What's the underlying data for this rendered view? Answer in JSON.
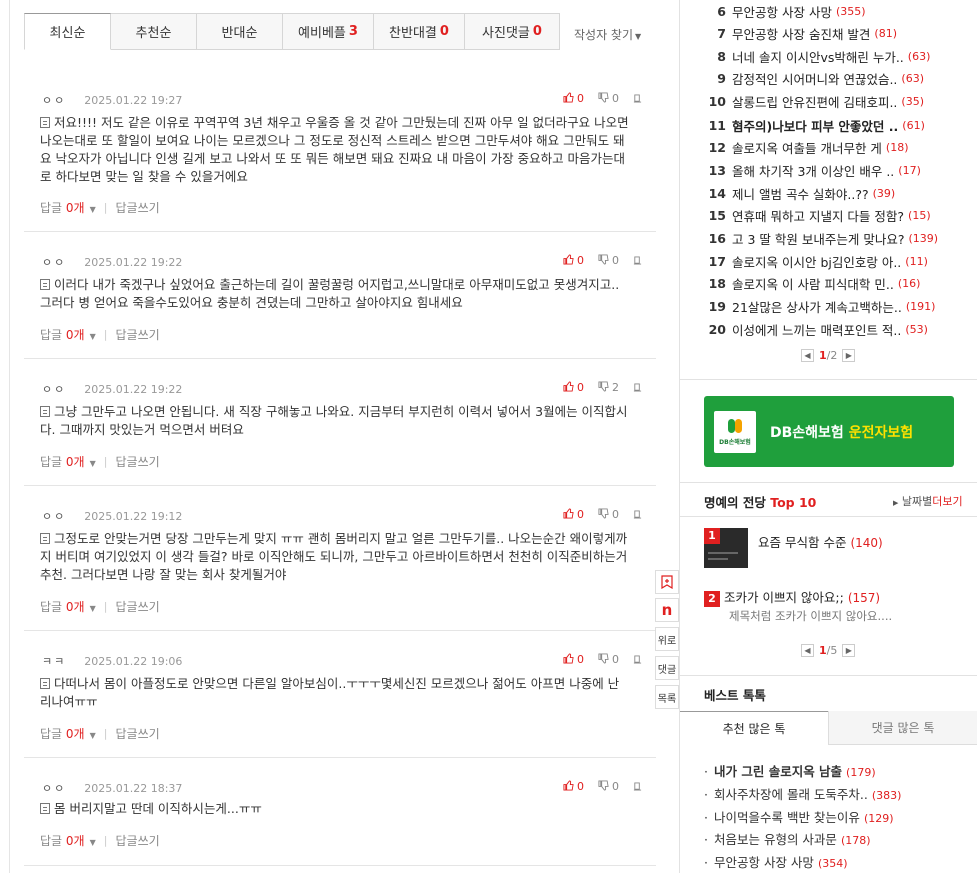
{
  "tabs": [
    {
      "label": "최신순",
      "count": ""
    },
    {
      "label": "추천순",
      "count": ""
    },
    {
      "label": "반대순",
      "count": ""
    },
    {
      "label": "예비베플",
      "count": "3"
    },
    {
      "label": "찬반대결",
      "count": "0"
    },
    {
      "label": "사진댓글",
      "count": "0"
    }
  ],
  "author_find": "작성자 찾기",
  "comments": [
    {
      "nick": "ㅇㅇ",
      "date": "2025.01.22 19:27",
      "up": "0",
      "down": "0",
      "body": "저요!!!! 저도 같은 이유로 꾸역꾸역 3년 채우고 우울증 올 것 같아 그만뒀는데 진짜 아무 일 없더라구요 나오면 나오는대로 또 할일이 보여요 나이는 모르겠으나 그 정도로 정신적 스트레스 받으면 그만두셔야 해요 그만둬도 돼요 낙오자가 아닙니다 인생 길게 보고 나와서 또 또 뭐든 해보면 돼요 진짜요 내 마음이 가장 중요하고 마음가는대로 하다보면 맞는 일 찾을 수 있을거에요",
      "reply_label": "답글",
      "reply_count": "0개",
      "write_reply": "답글쓰기"
    },
    {
      "nick": "ㅇㅇ",
      "date": "2025.01.22 19:22",
      "up": "0",
      "down": "0",
      "body": "이러다 내가 죽겠구나 싶었어요 출근하는데 길이 꿀렁꿀렁 어지럽고,쓰니말대로 아무재미도없고 못생겨지고..그러다 병 얻어요 죽을수도있어요 충분히 견뎠는데 그만하고 살아야지요 힘내세요",
      "reply_label": "답글",
      "reply_count": "0개",
      "write_reply": "답글쓰기"
    },
    {
      "nick": "ㅇㅇ",
      "date": "2025.01.22 19:22",
      "up": "0",
      "down": "2",
      "body": "그냥 그만두고 나오면 안됩니다. 새 직장 구해놓고 나와요. 지금부터 부지런히 이력서 넣어서 3월에는 이직합시다. 그때까지 맛있는거 먹으면서 버텨요",
      "reply_label": "답글",
      "reply_count": "0개",
      "write_reply": "답글쓰기"
    },
    {
      "nick": "ㅇㅇ",
      "date": "2025.01.22 19:12",
      "up": "0",
      "down": "0",
      "body": "그정도로 안맞는거면 당장 그만두는게 맞지 ㅠㅠ 괜히 몸버리지 말고 얼른 그만두기를.. 나오는순간 왜이렇게까지 버티며 여기있었지 이 생각 들걸? 바로 이직안해도 되니까, 그만두고 아르바이트하면서 천천히 이직준비하는거 추천. 그러다보면 나랑 잘 맞는 회사 찾게될거야",
      "reply_label": "답글",
      "reply_count": "0개",
      "write_reply": "답글쓰기"
    },
    {
      "nick": "ㅋㅋ",
      "date": "2025.01.22 19:06",
      "up": "0",
      "down": "0",
      "body": "다떠나서 몸이 아플정도로 안맞으면 다른일 알아보심이..ㅜㅜㅜ몇세신진 모르겠으나 젊어도 아프면 나중에 난리나여ㅠㅠ",
      "reply_label": "답글",
      "reply_count": "0개",
      "write_reply": "답글쓰기"
    },
    {
      "nick": "ㅇㅇ",
      "date": "2025.01.22 18:37",
      "up": "0",
      "down": "0",
      "body": "몸 버리지말고 딴데 이직하시는게...ㅠㅠ",
      "reply_label": "답글",
      "reply_count": "0개",
      "write_reply": "답글쓰기"
    }
  ],
  "float_buttons": {
    "bookmark": "",
    "nate": "n",
    "up": "위로",
    "comments": "댓글",
    "list": "목록"
  },
  "ranking": [
    {
      "num": "6",
      "title": "무안공항 사장 사망",
      "count": "(355)",
      "bold": false
    },
    {
      "num": "7",
      "title": "무안공항 사장 숨진채 발견",
      "count": "(81)",
      "bold": false
    },
    {
      "num": "8",
      "title": "너네 솔지 이시안vs박해린 누가..",
      "count": "(63)",
      "bold": false
    },
    {
      "num": "9",
      "title": "감정적인 시어머니와 연끊었슴..",
      "count": "(63)",
      "bold": false
    },
    {
      "num": "10",
      "title": "살롱드립 안유진편에 김태호피..",
      "count": "(35)",
      "bold": false
    },
    {
      "num": "11",
      "title": "혐주의)나보다 피부 안좋았던 ..",
      "count": "(61)",
      "bold": true
    },
    {
      "num": "12",
      "title": "솔로지옥 여출들 개너무한 게",
      "count": "(18)",
      "bold": false
    },
    {
      "num": "13",
      "title": "올해 차기작 3개 이상인 배우 ..",
      "count": "(17)",
      "bold": false
    },
    {
      "num": "14",
      "title": "제니 앨범 곡수 실화야..??",
      "count": "(39)",
      "bold": false
    },
    {
      "num": "15",
      "title": "연휴때 뭐하고 지낼지 다들 정함?",
      "count": "(15)",
      "bold": false
    },
    {
      "num": "16",
      "title": "고 3 딸 학원 보내주는게 맞나요?",
      "count": "(139)",
      "bold": false
    },
    {
      "num": "17",
      "title": "솔로지옥 이시안 bj김인호랑 아..",
      "count": "(11)",
      "bold": false
    },
    {
      "num": "18",
      "title": "솔로지옥 이 사람 피식대학 민..",
      "count": "(16)",
      "bold": false
    },
    {
      "num": "19",
      "title": "21살많은 상사가 계속고백하는..",
      "count": "(191)",
      "bold": false
    },
    {
      "num": "20",
      "title": "이성에게 느끼는 매력포인트 적..",
      "count": "(53)",
      "bold": false
    }
  ],
  "rank_pager": {
    "current": "1",
    "total": "/2"
  },
  "ad": {
    "logo_text": "DB손해보험",
    "brand": "DB손해보험",
    "product": "운전자보험"
  },
  "hall_of_fame": {
    "title_prefix": "명예의 전당",
    "title_hl": "Top 10",
    "more_prefix": "날짜별",
    "more_hl": "더보기",
    "items": [
      {
        "rank": "1",
        "title": "요즘 무식함 수준",
        "count": "(140)",
        "sub": ""
      },
      {
        "rank": "2",
        "title": "조카가 이쁘지 않아요;;",
        "count": "(157)",
        "sub": "제목처럼 조카가 이쁘지 않아요...."
      }
    ],
    "pager": {
      "current": "1",
      "total": "/5"
    }
  },
  "best_talk": {
    "title": "베스트 톡톡",
    "tabs": [
      "추천 많은 톡",
      "댓글 많은 톡"
    ],
    "items": [
      {
        "title": "내가 그린 솔로지옥 남출",
        "count": "(179)",
        "bold": true
      },
      {
        "title": "회사주차장에 몰래 도둑주차..",
        "count": "(383)",
        "bold": false
      },
      {
        "title": "나이먹을수록 백반 찾는이유",
        "count": "(129)",
        "bold": false
      },
      {
        "title": "처음보는 유형의 사과문",
        "count": "(178)",
        "bold": false
      },
      {
        "title": "무안공항 사장 사망",
        "count": "(354)",
        "bold": false
      }
    ]
  },
  "colors": {
    "accent_red": "#e02020",
    "ad_green": "#1f9f3c",
    "ad_highlight": "#ffe100"
  }
}
